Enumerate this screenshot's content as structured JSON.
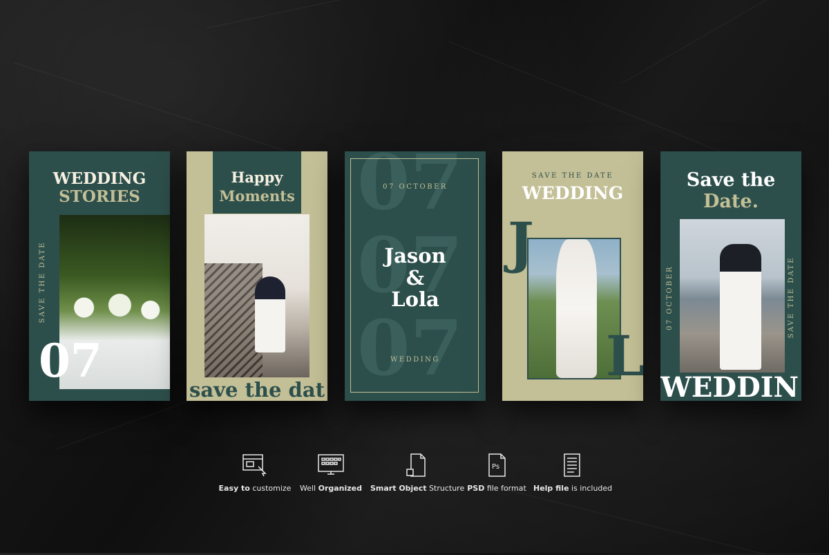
{
  "cards": [
    {
      "title_line1": "WEDDING",
      "title_line2": "STORIES",
      "side_text": "SAVE THE DATE",
      "number": "07"
    },
    {
      "title_line1": "Happy",
      "title_line2": "Moments",
      "footer_text": "save the dat"
    },
    {
      "date": "07 OCTOBER",
      "name1": "Jason",
      "amp": "&",
      "name2": "Lola",
      "footer": "WEDDING",
      "watermark": "07"
    },
    {
      "kicker": "SAVE THE DATE",
      "title": "WEDDING",
      "initial_left": "J",
      "initial_right": "L"
    },
    {
      "title_line1": "Save the",
      "title_line2": "Date.",
      "side_left": "07 OCTOBER",
      "side_right": "SAVE THE DATE",
      "footer_text": "WEDDIN"
    }
  ],
  "features": [
    {
      "icon": "customize-icon",
      "bold": "Easy to",
      "rest": " customize"
    },
    {
      "icon": "keyboard-monitor-icon",
      "pre": "Well ",
      "bold": "Organized"
    },
    {
      "icon": "smart-object-icon",
      "bold": "Smart Object",
      "rest": " Structure"
    },
    {
      "icon": "psd-file-icon",
      "bold": "PSD",
      "rest": " file format"
    },
    {
      "icon": "help-file-icon",
      "bold": "Help file",
      "rest": " is included"
    }
  ],
  "colors": {
    "green": "#2d4f4c",
    "sage": "#c3bf96",
    "cream": "#f6f1e2"
  }
}
